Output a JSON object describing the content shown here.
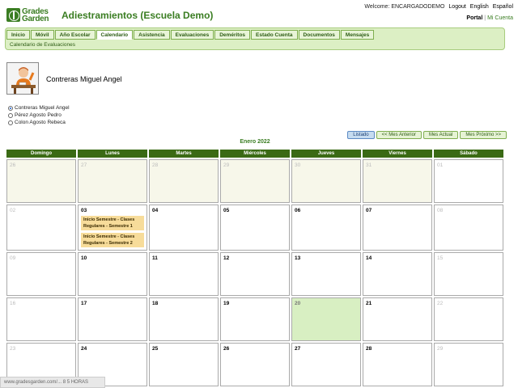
{
  "brand": {
    "logo_line1": "Grades",
    "logo_line2": "Garden"
  },
  "app_title": "Adiestramientos (Escuela Demo)",
  "header": {
    "welcome": "Welcome: ENCARGADODEMO",
    "logout": "Logout",
    "lang_en": "English",
    "lang_es": "Español",
    "portal": "Portal",
    "separator": "|",
    "my_account": "Mi Cuenta"
  },
  "nav": {
    "tabs": [
      "Inicio",
      "Móvil",
      "Año Escolar",
      "Calendario",
      "Asistencia",
      "Evaluaciones",
      "Deméritos",
      "Estado Cuenta",
      "Documentos",
      "Mensajes"
    ],
    "active_index": 3,
    "subnav": "Calendario de Evaluaciones"
  },
  "student": {
    "name": "Contreras Miguel Angel",
    "avatar_icon": "student-at-desk-icon"
  },
  "students": [
    {
      "name": "Contreras Miguel Angel",
      "checked": true
    },
    {
      "name": "Pérez Agosto Pedro",
      "checked": false
    },
    {
      "name": "Colon Agosto Rebeca",
      "checked": false
    }
  ],
  "controls": {
    "list": "Listado",
    "prev": "<< Mes Anterior",
    "current": "Mes Actual",
    "next": "Mes Próximo >>"
  },
  "calendar": {
    "month": "Enero 2022",
    "days": [
      "Domingo",
      "Lunes",
      "Martes",
      "Miércoles",
      "Jueves",
      "Viernes",
      "Sábado"
    ],
    "weeks": [
      [
        {
          "d": "26",
          "type": "other"
        },
        {
          "d": "27",
          "type": "other"
        },
        {
          "d": "28",
          "type": "other"
        },
        {
          "d": "29",
          "type": "other"
        },
        {
          "d": "30",
          "type": "other"
        },
        {
          "d": "31",
          "type": "other"
        },
        {
          "d": "01",
          "type": "weekend"
        }
      ],
      [
        {
          "d": "02",
          "type": "weekend"
        },
        {
          "d": "03",
          "type": "normal",
          "events": [
            "Inicio Semestre - Clases Regulares - Semestre 1",
            "Inicio Semestre - Clases Regulares - Semestre 2"
          ]
        },
        {
          "d": "04",
          "type": "normal"
        },
        {
          "d": "05",
          "type": "normal"
        },
        {
          "d": "06",
          "type": "normal"
        },
        {
          "d": "07",
          "type": "normal"
        },
        {
          "d": "08",
          "type": "weekend"
        }
      ],
      [
        {
          "d": "09",
          "type": "weekend"
        },
        {
          "d": "10",
          "type": "normal"
        },
        {
          "d": "11",
          "type": "normal"
        },
        {
          "d": "12",
          "type": "normal"
        },
        {
          "d": "13",
          "type": "normal"
        },
        {
          "d": "14",
          "type": "normal"
        },
        {
          "d": "15",
          "type": "weekend"
        }
      ],
      [
        {
          "d": "16",
          "type": "weekend"
        },
        {
          "d": "17",
          "type": "normal"
        },
        {
          "d": "18",
          "type": "normal"
        },
        {
          "d": "19",
          "type": "normal"
        },
        {
          "d": "20",
          "type": "today"
        },
        {
          "d": "21",
          "type": "normal"
        },
        {
          "d": "22",
          "type": "weekend"
        }
      ],
      [
        {
          "d": "23",
          "type": "weekend"
        },
        {
          "d": "24",
          "type": "normal"
        },
        {
          "d": "25",
          "type": "normal"
        },
        {
          "d": "26",
          "type": "normal"
        },
        {
          "d": "27",
          "type": "normal"
        },
        {
          "d": "28",
          "type": "normal"
        },
        {
          "d": "29",
          "type": "weekend"
        }
      ]
    ]
  },
  "status_bar": "www.gradesgarden.com/... 8 5 HORAS"
}
